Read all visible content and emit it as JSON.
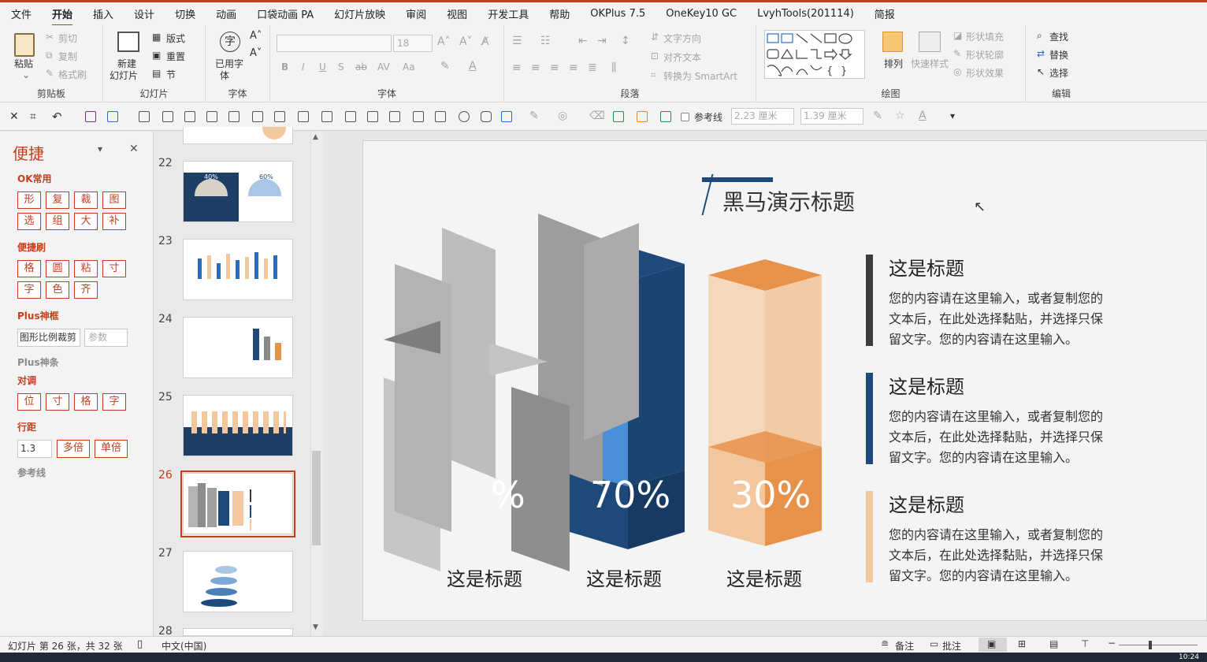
{
  "tabs": [
    "文件",
    "开始",
    "插入",
    "设计",
    "切换",
    "动画",
    "口袋动画 PA",
    "幻灯片放映",
    "审阅",
    "视图",
    "开发工具",
    "帮助",
    "OKPlus 7.5",
    "OneKey10 GC",
    "LvyhTools(201114)",
    "简报"
  ],
  "ribbon": {
    "clipboard": {
      "label": "剪贴板",
      "paste": "粘贴",
      "cut": "剪切",
      "copy": "复制",
      "format_painter": "格式刷"
    },
    "slides": {
      "label": "幻灯片",
      "new_slide": "新建",
      "new_slide2": "幻灯片",
      "layout": "版式",
      "reset": "重置",
      "section": "节"
    },
    "fontgrp": {
      "label": "字体",
      "used_fonts": "已用字",
      "used_fonts2": "体",
      "font_size": "18",
      "case": "Aa"
    },
    "font_label": "字体",
    "paragraph": {
      "label": "段落",
      "text_direction": "文字方向",
      "align_text": "对齐文本",
      "smartart": "转换为 SmartArt"
    },
    "drawing": {
      "label": "绘图",
      "arrange": "排列",
      "quick_styles": "快速样式",
      "shape_fill": "形状填充",
      "shape_outline": "形状轮廓",
      "shape_effects": "形状效果"
    },
    "editing": {
      "label": "编辑",
      "find": "查找",
      "replace": "替换",
      "select": "选择"
    }
  },
  "qat": {
    "guides": "参考线",
    "width": "2.23 厘米",
    "height": "1.39 厘米"
  },
  "pane": {
    "title": "便捷",
    "ok_section": "OK常用",
    "ok_buttons": [
      "形",
      "复",
      "裁",
      "图",
      "选",
      "组",
      "大",
      "补"
    ],
    "brush_section": "便捷刷",
    "brush_buttons": [
      "格",
      "圆",
      "粘",
      "寸",
      "字",
      "色",
      "齐"
    ],
    "plus_frame": "Plus神框",
    "crop_input": "图形比例裁剪",
    "param_placeholder": "参数",
    "plus_bar": "Plus神条",
    "align_section": "对调",
    "align_buttons": [
      "位",
      "寸",
      "格",
      "字"
    ],
    "spacing_section": "行距",
    "spacing_value": "1.3",
    "multi": "多倍",
    "single": "单倍",
    "guides_section": "参考线"
  },
  "thumbs": {
    "numbers": [
      "22",
      "23",
      "24",
      "25",
      "26",
      "27",
      "28"
    ],
    "active": "26",
    "t22_a": "40%",
    "t22_b": "60%"
  },
  "slide": {
    "title": "黑马演示标题",
    "bars": [
      {
        "pct": "%",
        "label": "这是标题"
      },
      {
        "pct": "70%",
        "label": "这是标题"
      },
      {
        "pct": "30%",
        "label": "这是标题"
      }
    ],
    "items": [
      {
        "heading": "这是标题",
        "body": [
          "您的内容请在这里输入，或者复制您的",
          "文本后，在此处选择黏贴，并选择只保",
          "留文字。您的内容请在这里输入。"
        ]
      },
      {
        "heading": "这是标题",
        "body": [
          "您的内容请在这里输入，或者复制您的",
          "文本后，在此处选择黏贴，并选择只保",
          "留文字。您的内容请在这里输入。"
        ]
      },
      {
        "heading": "这是标题",
        "body": [
          "您的内容请在这里输入，或者复制您的",
          "文本后，在此处选择黏贴，并选择只保",
          "留文字。您的内容请在这里输入。"
        ]
      }
    ],
    "colors": {
      "dark": "#3d3d3d",
      "navy": "#1d4a7a",
      "orange": "#e6924a",
      "peach": "#f2c79d"
    }
  },
  "status": {
    "slide_info": "幻灯片 第 26 张，共 32 张",
    "language": "中文(中国)",
    "notes": "备注",
    "comments": "批注",
    "time": "10:24"
  }
}
